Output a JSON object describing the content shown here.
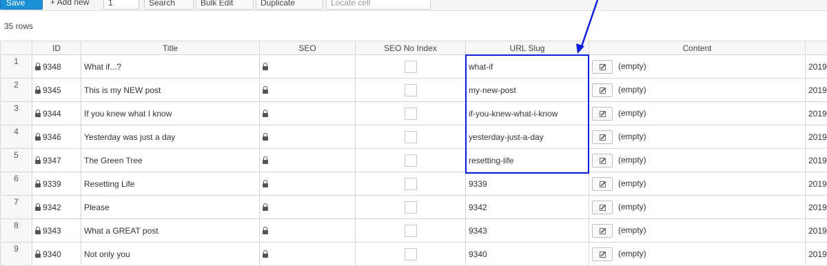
{
  "toolbar": {
    "save_label": "Save",
    "add_new_label": "+ Add new",
    "add_count_value": "1",
    "search_label": "Search",
    "bulk_edit_label": "Bulk Edit",
    "duplicate_label": "Duplicate",
    "locate_placeholder": "Locate cell"
  },
  "row_count": "35 rows",
  "columns": [
    "ID",
    "Title",
    "SEO",
    "SEO No Index",
    "URL Slug",
    "Content",
    ""
  ],
  "rows": [
    {
      "num": "1",
      "id": "9348",
      "title": "What if...?",
      "slug": "what-if",
      "content": "(empty)",
      "date": "2019"
    },
    {
      "num": "2",
      "id": "9345",
      "title": "This is my NEW post",
      "slug": "my-new-post",
      "content": "(empty)",
      "date": "2019"
    },
    {
      "num": "3",
      "id": "9344",
      "title": "If you knew what I know",
      "slug": "if-you-knew-what-i-know",
      "content": "(empty)",
      "date": "2019"
    },
    {
      "num": "4",
      "id": "9346",
      "title": "Yesterday was just a day",
      "slug": "yesterday-just-a-day",
      "content": "(empty)",
      "date": "2019"
    },
    {
      "num": "5",
      "id": "9347",
      "title": "The Green Tree",
      "slug": "resetting-life",
      "content": "(empty)",
      "date": "2019"
    },
    {
      "num": "6",
      "id": "9339",
      "title": "Resetting Life",
      "slug": "9339",
      "content": "(empty)",
      "date": "2019"
    },
    {
      "num": "7",
      "id": "9342",
      "title": "Please",
      "slug": "9342",
      "content": "(empty)",
      "date": "2019"
    },
    {
      "num": "8",
      "id": "9343",
      "title": "What a GREAT post",
      "slug": "9343",
      "content": "(empty)",
      "date": "2019"
    },
    {
      "num": "9",
      "id": "9340",
      "title": "Not only you",
      "slug": "9340",
      "content": "(empty)",
      "date": "2019"
    }
  ],
  "colors": {
    "highlight": "#0a1ee0",
    "save_button": "#1a8fd6"
  },
  "icons": [
    "save-icon",
    "search-icon",
    "bulk-edit-icon",
    "duplicate-icon",
    "lock-icon",
    "edit-icon",
    "annotation-arrow"
  ]
}
